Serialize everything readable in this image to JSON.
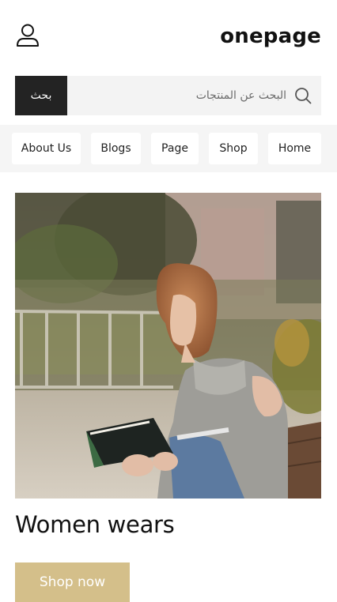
{
  "header": {
    "logo_text": "onepage",
    "account_icon": "user-icon"
  },
  "search": {
    "placeholder": "البحث عن المنتجات",
    "button_label": "بحث",
    "icon": "search-icon"
  },
  "nav": {
    "items": [
      {
        "label": "About Us"
      },
      {
        "label": "Blogs"
      },
      {
        "label": "Page"
      },
      {
        "label": "Shop"
      },
      {
        "label": "Home"
      }
    ]
  },
  "hero": {
    "image_alt": "",
    "title": "Women wears",
    "button_label": "Shop now"
  },
  "colors": {
    "accent": "#d4bf8a",
    "search_button_bg": "#232323",
    "nav_bg": "#f5f5f5"
  }
}
